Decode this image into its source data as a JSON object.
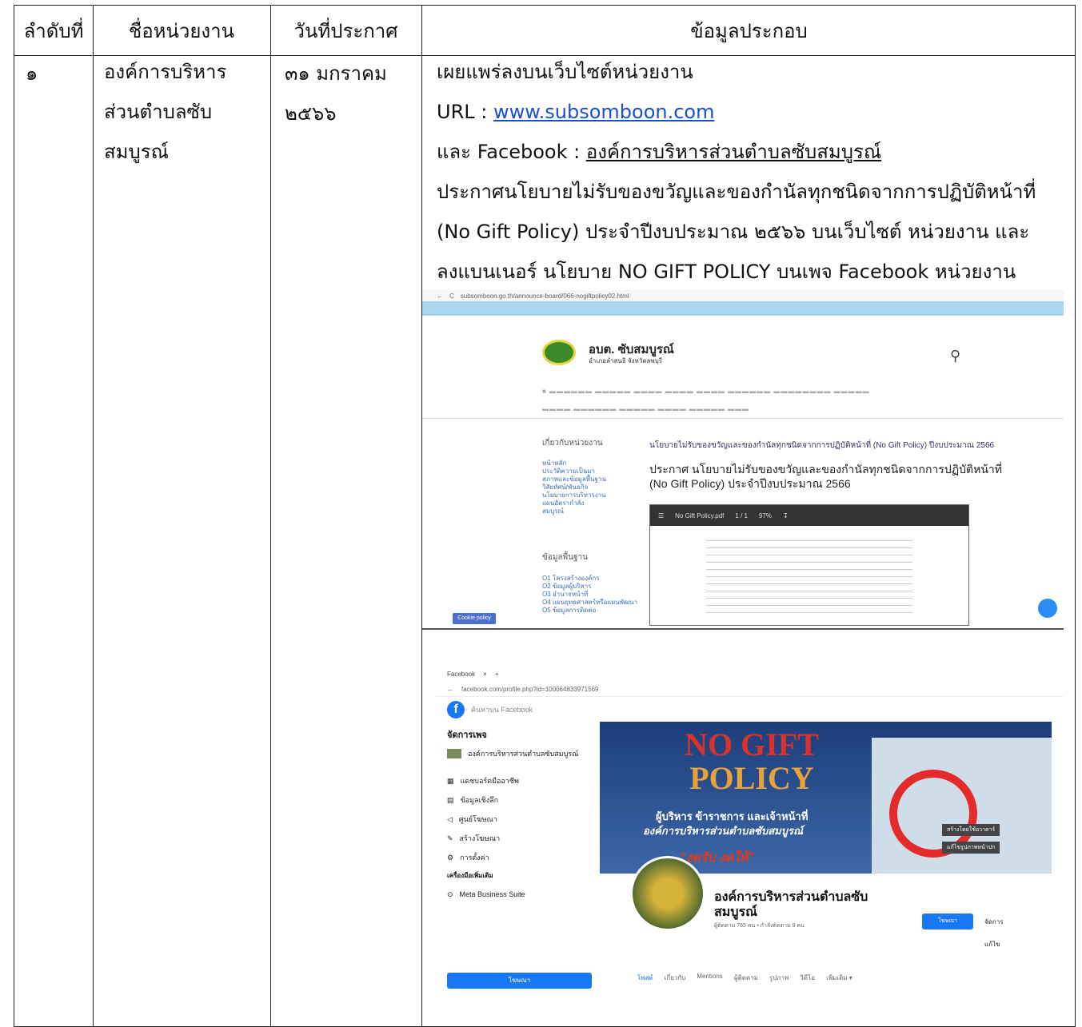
{
  "header": {
    "col1": "ลำดับที่",
    "col2": "ชื่อหน่วยงาน",
    "col3": "วันที่ประกาศ",
    "col4": "ข้อมูลประกอบ"
  },
  "row": {
    "number": "๑",
    "org_line1": "องค์การบริหาร",
    "org_line2": "ส่วนตำบลซับ",
    "org_line3": "สมบูรณ์",
    "date_line1": "๓๑  มกราคม",
    "date_line2": "๒๕๖๖",
    "info_line1": "เผยแพร่ลงบนเว็บไซต์หน่วยงาน",
    "url_label": "URL : ",
    "url_link": "www.subsomboon.com",
    "fb_label": "และ Facebook : ",
    "fb_link": "องค์การบริหารส่วนตำบลซับสมบูรณ์",
    "info_line4": "ประกาศนโยบายไม่รับของขวัญและของกำนัลทุกชนิดจากการปฏิบัติหน้าที่",
    "info_line5": "(No Gift Policy) ประจำปีงบประมาณ ๒๕๖๖ บนเว็บไซต์ หน่วยงาน  และ",
    "info_line6": "ลงแบนเนอร์ นโยบาย NO GIFT POLICY บนเพจ Facebook หน่วยงาน"
  },
  "website_shot": {
    "address": "subsomboon.go.th/announce-board/066-nogiftpolicy02.html",
    "site_title": "อบต. ซับสมบูรณ์",
    "site_subtitle": "อำเภอลำสนธิ จังหวัดลพบุรี",
    "sidebar_heading1": "เกี่ยวกับหน่วยงาน",
    "sidebar_items1": [
      "หน้าหลัก",
      "ประวัติความเป็นมา",
      "สภาพและข้อมูลพื้นฐาน",
      "วิสัยทัศน์/พันธกิจ",
      "นโยบายการบริหารงาน",
      "แผนอัตรากำลัง",
      "สมบูรณ์"
    ],
    "sidebar_heading2": "ข้อมูลพื้นฐาน",
    "sidebar_items2": [
      "O1 โครงสร้างองค์กร",
      "O2 ข้อมูลผู้บริหาร",
      "O3 อำนาจหน้าที่",
      "O4 แผนยุทธศาสตร์หรือแผนพัฒนา",
      "O5 ข้อมูลการติดต่อ"
    ],
    "breadcrumb": "นโยบายไม่รับของขวัญและของกำนัลทุกชนิดจากการปฏิบัติหน้าที่ (No Gift Policy) ปีงบประมาณ 2566",
    "heading_line1": "ประกาศ นโยบายไม่รับของขวัญและของกำนัลทุกชนิดจากการปฏิบัติหน้าที่",
    "heading_line2": "(No Gift Policy) ประจำปีงบประมาณ 2566",
    "pdf_name": "No Gift Policy.pdf",
    "pdf_pages": "1 / 1",
    "pdf_zoom": "97%",
    "cookie": "Cookie policy"
  },
  "facebook_shot": {
    "tab": "Facebook",
    "address": "facebook.com/profile.php?id=100064833971569",
    "search": "ค้นหาบน Facebook",
    "manage_page": "จัดการเพจ",
    "page_small": "องค์การบริหารส่วนตำบลซับสมบูรณ์",
    "menu": [
      "แดชบอร์ดมืออาชีพ",
      "ข้อมูลเชิงลึก",
      "ศูนย์โฆษณา",
      "สร้างโฆษณา",
      "การตั้งค่า"
    ],
    "tools": "เครื่องมือเพิ่มเติม",
    "meta": "Meta Business Suite",
    "banner_title1": "NO GIFT",
    "banner_title2": "POLICY",
    "banner_line1": "ผู้บริหาร ข้าราชการ และเจ้าหน้าที่",
    "banner_line2": "องค์การบริหารส่วนตำบลซับสมบูรณ์",
    "banner_line3": "\"งดรับ งดให้\"",
    "cover_btn1": "สร้างโดยใช้อวาตาร์",
    "cover_btn2": "แก้ไขรูปภาพหน้าปก",
    "page_name1": "องค์การบริหารส่วนตำบลซับ",
    "page_name2": "สมบูรณ์",
    "followers": "ผู้ติดตาม 765 คน • กำลังติดตาม 9 คน",
    "btn_ad": "โฆษณา",
    "btn_manage": "จัดการ",
    "btn_edit": "แก้ไข",
    "tabs": [
      "โพสต์",
      "เกี่ยวกับ",
      "Mentions",
      "ผู้ติดตาม",
      "รูปภาพ",
      "วิดีโอ",
      "เพิ่มเติม ▾"
    ],
    "cta": "โฆษณา"
  }
}
